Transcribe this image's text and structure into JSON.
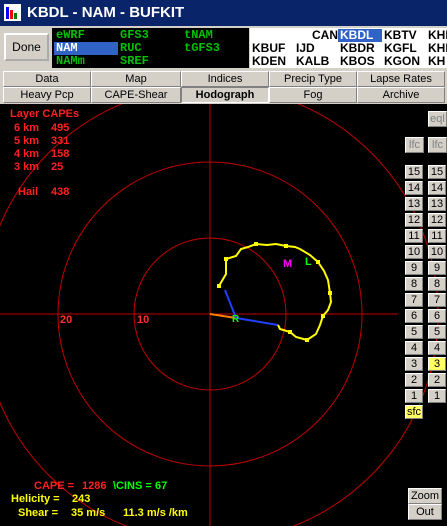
{
  "window": {
    "title": "KBDL - NAM - BUFKIT"
  },
  "done_button": "Done",
  "models": [
    {
      "label": "eWRF",
      "selected": false
    },
    {
      "label": "GFS3",
      "selected": false
    },
    {
      "label": "tNAM",
      "selected": false
    },
    {
      "label": "NAM",
      "selected": true
    },
    {
      "label": "RUC",
      "selected": false
    },
    {
      "label": "tGFS3",
      "selected": false
    },
    {
      "label": "NAMm",
      "selected": false
    },
    {
      "label": "SREF",
      "selected": false
    }
  ],
  "stations": [
    {
      "label": "CAN",
      "selected": false
    },
    {
      "label": "KBDL",
      "selected": true
    },
    {
      "label": "KBTV",
      "selected": false
    },
    {
      "label": "KHI",
      "selected": false
    },
    {
      "label": "KBUF",
      "selected": false
    },
    {
      "label": "IJD",
      "selected": false
    },
    {
      "label": "KBDR",
      "selected": false
    },
    {
      "label": "KGFL",
      "selected": false
    },
    {
      "label": "KHI",
      "selected": false
    },
    {
      "label": "KDEN",
      "selected": false
    },
    {
      "label": "KALB",
      "selected": false
    },
    {
      "label": "KBOS",
      "selected": false
    },
    {
      "label": "KGON",
      "selected": false
    },
    {
      "label": "KH",
      "selected": false
    }
  ],
  "tabs_row1": [
    "Data",
    "Map",
    "Indices",
    "Precip Type",
    "Lapse Rates"
  ],
  "tabs_row2": [
    "Heavy Pcp",
    "CAPE-Shear",
    "Hodograph",
    "Fog",
    "Archive"
  ],
  "active_tab": "Hodograph",
  "layer_capes": {
    "title": "Layer CAPEs",
    "rows": [
      {
        "label": "6 km",
        "value": "495"
      },
      {
        "label": "5 km",
        "value": "331"
      },
      {
        "label": "4 km",
        "value": "158"
      },
      {
        "label": "3 km",
        "value": "25"
      }
    ],
    "hail_label": "Hail",
    "hail_value": "438"
  },
  "ring_labels": [
    "20",
    "10"
  ],
  "markers": {
    "storm_motion": "M",
    "left_mover": "L",
    "right_mover": "R"
  },
  "stats": {
    "cape_label": "CAPE =",
    "cape_value": "1286",
    "cins_label": "\\CINS =",
    "cins_value": "67",
    "helicity_label": "Helicity =",
    "helicity_value": "243",
    "shear_label": "Shear =",
    "shear_value": "35 m/s",
    "shear_rate": "11.3 m/s /km"
  },
  "right_controls": {
    "eql": "eql",
    "lfc_left": "lfc",
    "lfc_right": "lfc",
    "levels_left": [
      "15",
      "14",
      "13",
      "12",
      "11",
      "10",
      "9",
      "8",
      "7",
      "6",
      "5",
      "4",
      "3",
      "2",
      "1"
    ],
    "levels_right": [
      "15",
      "14",
      "13",
      "12",
      "11",
      "10",
      "9",
      "8",
      "7",
      "6",
      "5",
      "4",
      "3",
      "2",
      "1"
    ],
    "sfc": "sfc",
    "highlighted_right_level": "3",
    "zoom": "Zoom",
    "out": "Out"
  },
  "colors": {
    "background": "#000000",
    "rings": "#c00000",
    "hodograph": "#ffff00",
    "cape_text": "#ff2020",
    "cins_text": "#00ff00",
    "helicity_text": "#ffff00",
    "storm_motion": "#ff00ff",
    "left_mover": "#00ff00"
  }
}
